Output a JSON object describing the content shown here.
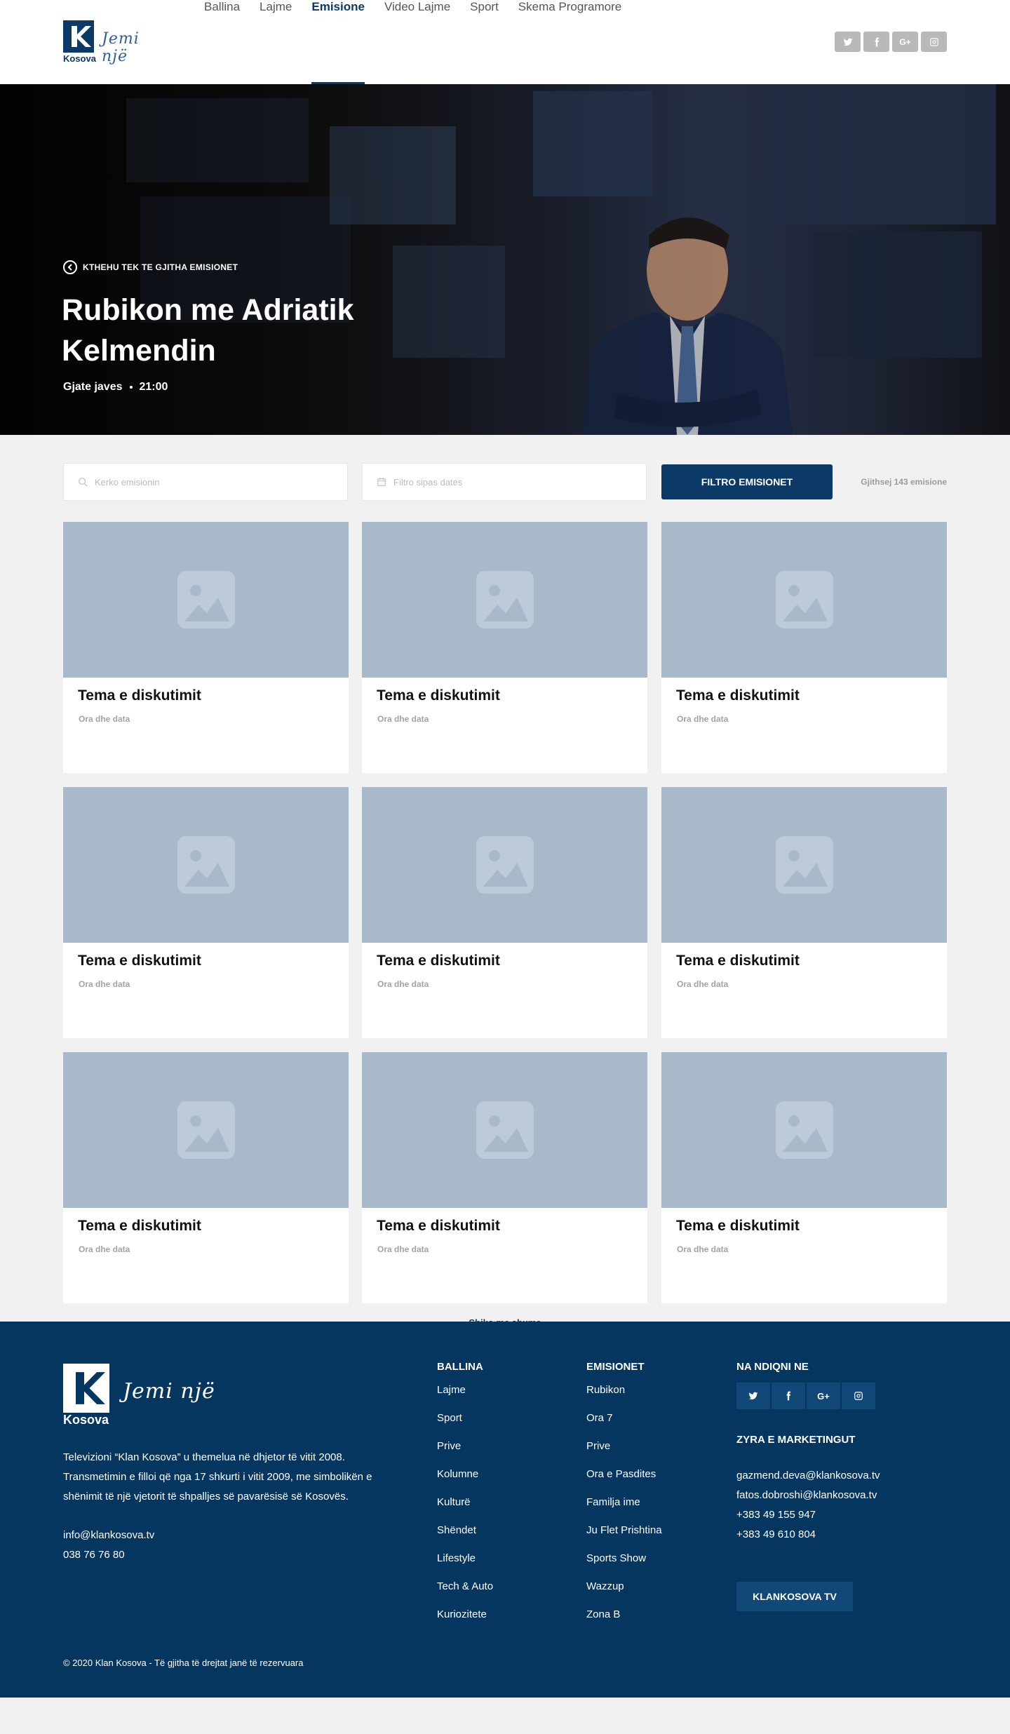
{
  "header": {
    "logo_text": "Kosova",
    "logo_script": "Jemi një",
    "nav": [
      {
        "label": "Ballina",
        "active": false
      },
      {
        "label": "Lajme",
        "active": false
      },
      {
        "label": "Emisione",
        "active": true
      },
      {
        "label": "Video Lajme",
        "active": false
      },
      {
        "label": "Sport",
        "active": false
      },
      {
        "label": "Skema Programore",
        "active": false
      }
    ],
    "social": [
      "twitter-icon",
      "facebook-icon",
      "google-plus-icon",
      "instagram-icon"
    ],
    "gplus_label": "G+"
  },
  "hero": {
    "back_label": "KTHEHU TEK TE GJITHA EMISIONET",
    "title": "Rubikon me Adriatik Kelmendin",
    "schedule": "Gjate javes",
    "time": "21:00"
  },
  "filters": {
    "search_placeholder": "Kerko emisionin",
    "date_placeholder": "Filtro sipas dates",
    "button_label": "FILTRO EMISIONET",
    "total_label": "Gjithsej 143 emisione"
  },
  "cards": [
    {
      "title": "Tema e diskutimit",
      "date": "Ora dhe data"
    },
    {
      "title": "Tema e diskutimit",
      "date": "Ora dhe data"
    },
    {
      "title": "Tema e diskutimit",
      "date": "Ora dhe data"
    },
    {
      "title": "Tema e diskutimit",
      "date": "Ora dhe data"
    },
    {
      "title": "Tema e diskutimit",
      "date": "Ora dhe data"
    },
    {
      "title": "Tema e diskutimit",
      "date": "Ora dhe data"
    },
    {
      "title": "Tema e diskutimit",
      "date": "Ora dhe data"
    },
    {
      "title": "Tema e diskutimit",
      "date": "Ora dhe data"
    },
    {
      "title": "Tema e diskutimit",
      "date": "Ora dhe data"
    }
  ],
  "more_label": "Shiko me shume",
  "footer": {
    "logo_text": "Kosova",
    "logo_script": "Jemi një",
    "description": "Televizioni “Klan Kosova” u themelua në dhjetor të vitit 2008. Transmetimin e filloi që nga 17 shkurti i vitit 2009, me simbolikën e shënimit të një vjetorit të shpalljes së pavarësisë së Kosovës.",
    "email": "info@klankosova.tv",
    "phone": "038 76 76 80",
    "col1": {
      "heading": "BALLINA",
      "links": [
        "Lajme",
        "Sport",
        "Prive",
        "Kolumne",
        "Kulturë",
        "Shëndet",
        "Lifestyle",
        "Tech & Auto",
        "Kuriozitete"
      ]
    },
    "col2": {
      "heading": "EMISIONET",
      "links": [
        "Rubikon",
        "Ora 7",
        "Prive",
        "Ora e Pasdites",
        "Familja ime",
        "Ju Flet Prishtina",
        "Sports Show",
        "Wazzup",
        "Zona B"
      ]
    },
    "follow_heading": "NA NDIQNI NE",
    "marketing_heading": "ZYRA E MARKETINGUT",
    "emails": [
      "gazmend.deva@klankosova.tv",
      "fatos.dobroshi@klankosova.tv"
    ],
    "phones": [
      "+383 49 155 947",
      "+383 49 610 804"
    ],
    "tv_button": "KLANKOSOVA TV",
    "copyright": "© 2020 Klan Kosova - Të gjitha të drejtat janë të rezervuara"
  },
  "colors": {
    "brand": "#0b3a66",
    "footer_bg": "#05365f",
    "placeholder": "#a8bac9"
  }
}
